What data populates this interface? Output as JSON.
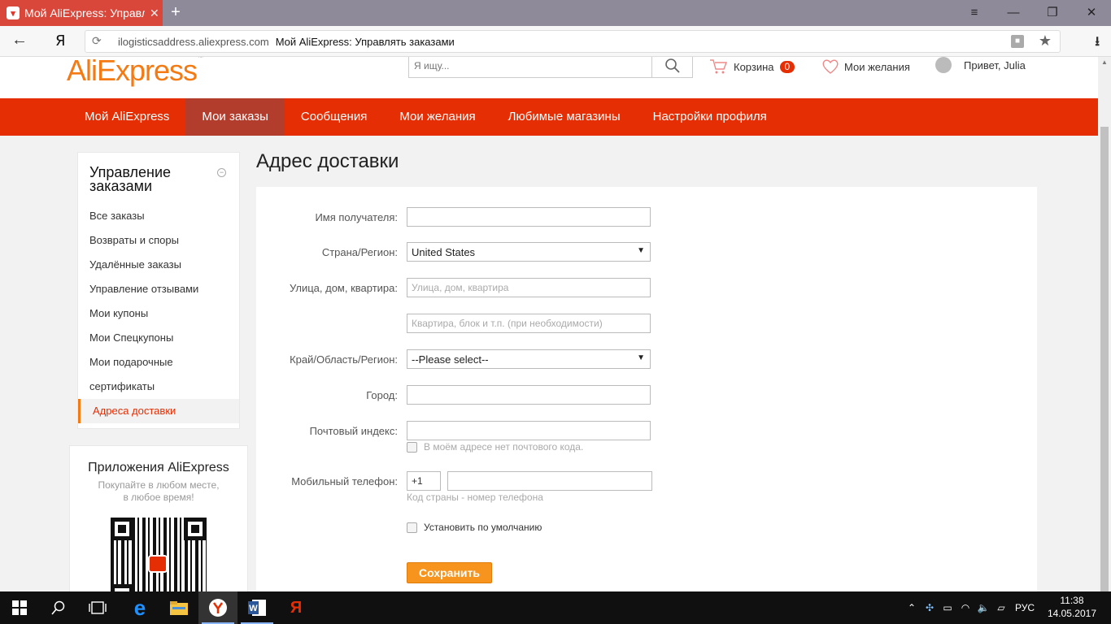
{
  "browser": {
    "tab_title": "Мой AliExpress: Управлять заказами",
    "tab_close": "✕",
    "new_tab": "+",
    "window_controls": {
      "menu": "≡",
      "minimize": "—",
      "restore": "❐",
      "close": "✕"
    },
    "back": "←",
    "yandex_button": "Я",
    "refresh": "⟳",
    "url": "ilogisticsaddress.aliexpress.com",
    "page_title": "Мой AliExpress: Управлять заказами",
    "lock": "🔒",
    "star": "★",
    "download": "⭳"
  },
  "header": {
    "logo": "AliExpress",
    "logo_tm": "™",
    "search_placeholder": "Я ищу...",
    "cart_label": "Корзина",
    "cart_count": "0",
    "wishlist_label": "Мои желания",
    "greeting": "Привет, Julia"
  },
  "nav": {
    "items": [
      {
        "label": "Мой AliExpress"
      },
      {
        "label": "Мои заказы",
        "active": true
      },
      {
        "label": "Сообщения"
      },
      {
        "label": "Мои желания"
      },
      {
        "label": "Любимые магазины"
      },
      {
        "label": "Настройки профиля"
      }
    ]
  },
  "sidebar": {
    "title": "Управление заказами",
    "collapse": "−",
    "items": [
      "Все заказы",
      "Возвраты и споры",
      "Удалённые заказы",
      "Управление отзывами",
      "Мои купоны",
      "Мои Спецкупоны",
      "Мои подарочные",
      "сертификаты",
      "Адреса доставки"
    ]
  },
  "apps": {
    "title": "Приложения AliExpress",
    "subtitle": "Покупайте в любом месте, в любое время!"
  },
  "form": {
    "title": "Адрес доставки",
    "recipient_label": "Имя получателя:",
    "recipient_value": "",
    "country_label": "Страна/Регион:",
    "country_value": "United States",
    "street_label": "Улица, дом, квартира:",
    "street_placeholder": "Улица, дом, квартира",
    "apt_placeholder": "Квартира, блок и т.п. (при необходимости)",
    "region_label": "Край/Область/Регион:",
    "region_value": "--Please select--",
    "city_label": "Город:",
    "zip_label": "Почтовый индекс:",
    "no_zip_label": "В моём адресе нет почтового кода.",
    "phone_label": "Мобильный телефон:",
    "phone_code": "+1",
    "phone_hint": "Код страны - номер телефона",
    "default_label": "Установить по умолчанию",
    "save_label": "Сохранить"
  },
  "taskbar": {
    "language": "РУС",
    "time": "11:38",
    "date": "14.05.2017"
  }
}
